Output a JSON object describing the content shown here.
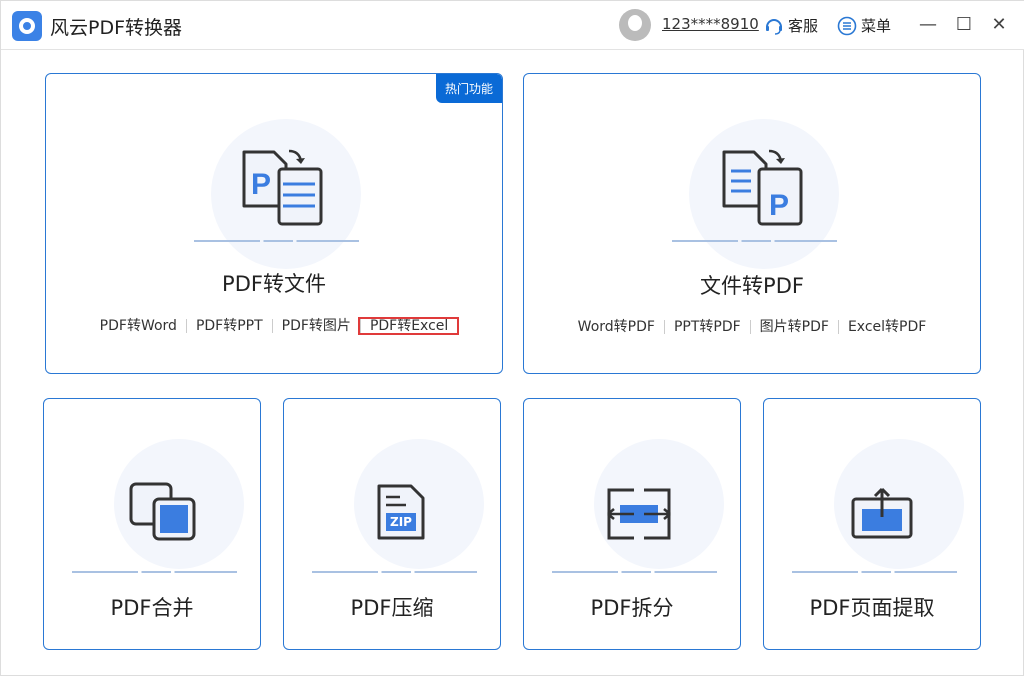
{
  "app": {
    "title": "风云PDF转换器"
  },
  "header": {
    "user": "123****8910",
    "service": "客服",
    "menu": "菜单"
  },
  "cards": [
    {
      "title": "PDF转文件",
      "badge": "热门功能",
      "links": [
        "PDF转Word",
        "PDF转PPT",
        "PDF转图片",
        "PDF转Excel"
      ],
      "highlighted": "PDF转Excel"
    },
    {
      "title": "文件转PDF",
      "links": [
        "Word转PDF",
        "PPT转PDF",
        "图片转PDF",
        "Excel转PDF"
      ]
    },
    {
      "title": "PDF合并"
    },
    {
      "title": "PDF压缩",
      "icon_label": "ZIP"
    },
    {
      "title": "PDF拆分"
    },
    {
      "title": "PDF页面提取"
    }
  ],
  "colors": {
    "accent": "#2a78d4",
    "icon_blue": "#3b7de0",
    "badge": "#0a6ad6",
    "highlight": "#e03a3a"
  }
}
